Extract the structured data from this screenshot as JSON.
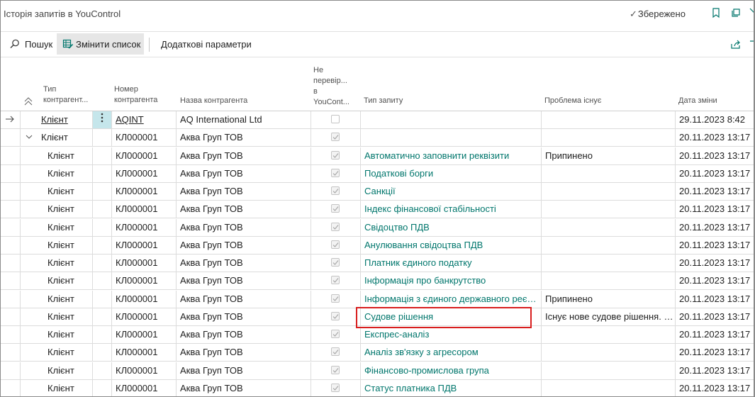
{
  "window": {
    "title": "Історія запитів в YouControl",
    "saved_label": "Збережено"
  },
  "toolbar": {
    "search_label": "Пошук",
    "edit_list_label": "Змінити список",
    "more_params_label": "Додаткові параметри"
  },
  "table": {
    "headers": {
      "type": "Тип контрагент...",
      "type_line1": "Тип",
      "type_line2": "контрагент...",
      "number_line1": "Номер",
      "number_line2": "контрагента",
      "name": "Назва контрагента",
      "unverified_line1": "Не",
      "unverified_line2": "перевір...",
      "unverified_line3": "в",
      "unverified_line4": "YouCont...",
      "request_type": "Тип запиту",
      "problem": "Проблема існує",
      "date": "Дата зміни"
    },
    "rows": [
      {
        "type": "Клієнт",
        "number": "AQINT",
        "name": "AQ International Ltd",
        "checked": false,
        "request": "",
        "problem": "",
        "date": "29.11.2023 8:42",
        "current": true
      },
      {
        "type": "Клієнт",
        "number": "КЛ000001",
        "name": "Аква Груп ТОВ",
        "checked": true,
        "request": "",
        "problem": "",
        "date": "20.11.2023 13:17",
        "group": true
      },
      {
        "type": "Клієнт",
        "number": "КЛ000001",
        "name": "Аква Груп ТОВ",
        "checked": true,
        "request": "Автоматично заповнити реквізити",
        "problem": "Припинено",
        "date": "20.11.2023 13:17"
      },
      {
        "type": "Клієнт",
        "number": "КЛ000001",
        "name": "Аква Груп ТОВ",
        "checked": true,
        "request": "Податкові борги",
        "problem": "",
        "date": "20.11.2023 13:17"
      },
      {
        "type": "Клієнт",
        "number": "КЛ000001",
        "name": "Аква Груп ТОВ",
        "checked": true,
        "request": "Санкції",
        "problem": "",
        "date": "20.11.2023 13:17"
      },
      {
        "type": "Клієнт",
        "number": "КЛ000001",
        "name": "Аква Груп ТОВ",
        "checked": true,
        "request": "Індекс фінансової стабільності",
        "problem": "",
        "date": "20.11.2023 13:17"
      },
      {
        "type": "Клієнт",
        "number": "КЛ000001",
        "name": "Аква Груп ТОВ",
        "checked": true,
        "request": "Свідоцтво ПДВ",
        "problem": "",
        "date": "20.11.2023 13:17"
      },
      {
        "type": "Клієнт",
        "number": "КЛ000001",
        "name": "Аква Груп ТОВ",
        "checked": true,
        "request": "Анулювання свідоцтва ПДВ",
        "problem": "",
        "date": "20.11.2023 13:17"
      },
      {
        "type": "Клієнт",
        "number": "КЛ000001",
        "name": "Аква Груп ТОВ",
        "checked": true,
        "request": "Платник єдиного податку",
        "problem": "",
        "date": "20.11.2023 13:17"
      },
      {
        "type": "Клієнт",
        "number": "КЛ000001",
        "name": "Аква Груп ТОВ",
        "checked": true,
        "request": "Інформація про банкрутство",
        "problem": "",
        "date": "20.11.2023 13:17"
      },
      {
        "type": "Клієнт",
        "number": "КЛ000001",
        "name": "Аква Груп ТОВ",
        "checked": true,
        "request": "Інформація з єдиного державного реєст...",
        "problem": "Припинено",
        "date": "20.11.2023 13:17"
      },
      {
        "type": "Клієнт",
        "number": "КЛ000001",
        "name": "Аква Груп ТОВ",
        "checked": true,
        "request": "Судове рішення",
        "problem": "Існує нове судове рішення. П...",
        "date": "20.11.2023 13:17"
      },
      {
        "type": "Клієнт",
        "number": "КЛ000001",
        "name": "Аква Груп ТОВ",
        "checked": true,
        "request": "Експрес-аналіз",
        "problem": "",
        "date": "20.11.2023 13:17"
      },
      {
        "type": "Клієнт",
        "number": "КЛ000001",
        "name": "Аква Груп ТОВ",
        "checked": true,
        "request": "Аналіз зв'язку з агресором",
        "problem": "",
        "date": "20.11.2023 13:17"
      },
      {
        "type": "Клієнт",
        "number": "КЛ000001",
        "name": "Аква Груп ТОВ",
        "checked": true,
        "request": "Фінансово-промислова група",
        "problem": "",
        "date": "20.11.2023 13:17"
      },
      {
        "type": "Клієнт",
        "number": "КЛ000001",
        "name": "Аква Груп ТОВ",
        "checked": true,
        "request": "Статус платника ПДВ",
        "problem": "",
        "date": "20.11.2023 13:17"
      }
    ]
  },
  "colors": {
    "accent": "#00766c",
    "highlight": "#d81e1e",
    "action_active": "#e6e6e6",
    "selected_cell": "#c5e6eb"
  }
}
